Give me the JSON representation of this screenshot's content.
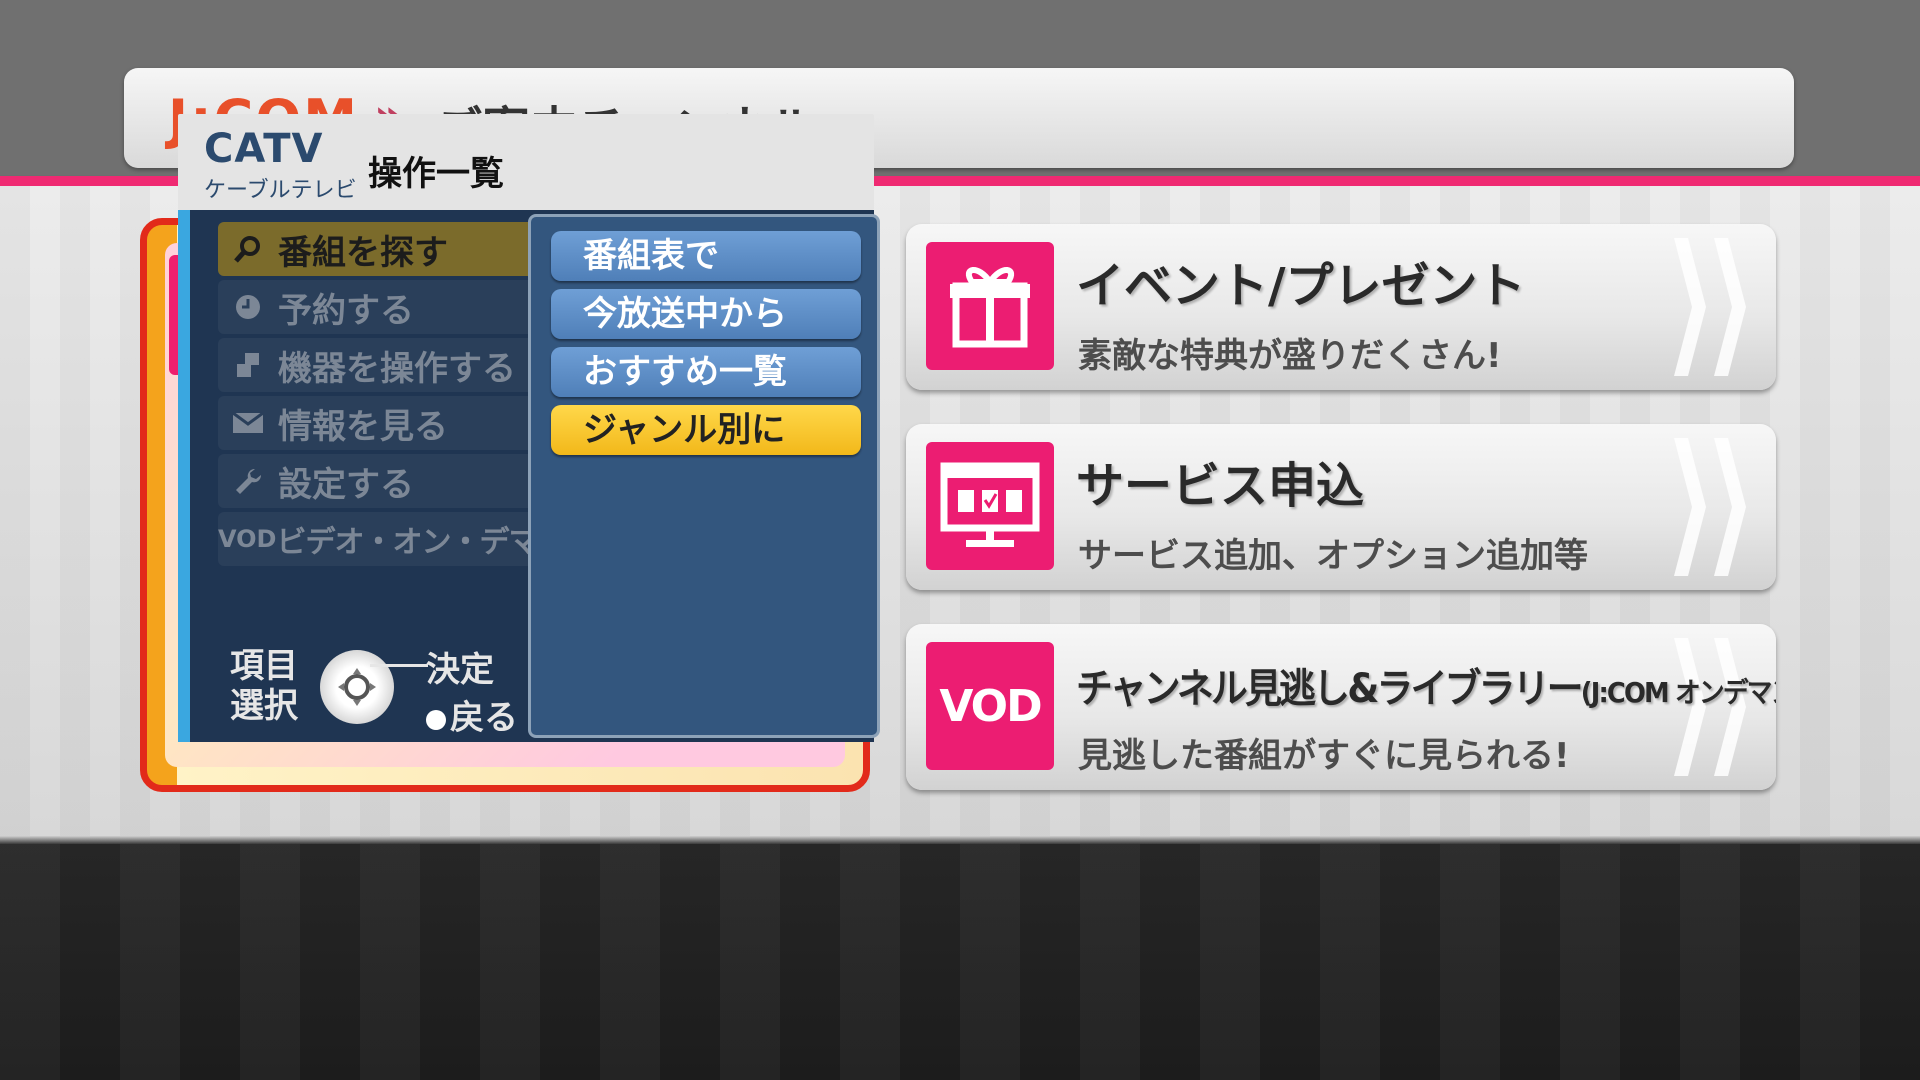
{
  "background": {
    "header_logo": "J:COM",
    "header_separator": "»",
    "header_title": "ご案内チャンネル"
  },
  "cards": [
    {
      "icon": "gift-icon",
      "title": "イベント/プレゼント",
      "subtitle": "素敵な特典が盛りだくさん!"
    },
    {
      "icon": "monitor-check-icon",
      "title": "サービス申込",
      "subtitle": "サービス追加、オプション追加等"
    },
    {
      "icon": "vod-icon",
      "icon_text": "VOD",
      "title": "チャンネル見逃し&ライブラリー",
      "title_suffix": "(J:COM オンデマンド)",
      "subtitle": "見逃した番組がすぐに見られる!"
    }
  ],
  "menu": {
    "logo": "CATV",
    "logo_sub": "ケーブルテレビ",
    "title": "操作一覧",
    "left_items": [
      {
        "icon": "search-icon",
        "label": "番組を探す",
        "active": true
      },
      {
        "icon": "clock-icon",
        "label": "予約する"
      },
      {
        "icon": "device-icon",
        "label": "機器を操作する"
      },
      {
        "icon": "mail-icon",
        "label": "情報を見る"
      },
      {
        "icon": "wrench-icon",
        "label": "設定する"
      },
      {
        "icon": "vod-icon",
        "icon_text": "VOD",
        "label": "ビデオ・オン・デマンド"
      }
    ],
    "sub_items": [
      {
        "label": "番組表で"
      },
      {
        "label": "今放送中から"
      },
      {
        "label": "おすすめ一覧"
      },
      {
        "label": "ジャンル別に",
        "selected": true
      }
    ],
    "help": {
      "select_label_1": "項目",
      "select_label_2": "選択",
      "ok_label": "決定",
      "back_label": "戻る"
    }
  },
  "colors": {
    "accent_pink": "#ec1d72",
    "menu_bg": "#1f3552",
    "selected_yellow": "#ffd84a",
    "sub_item_blue": "#5a8ac4"
  }
}
